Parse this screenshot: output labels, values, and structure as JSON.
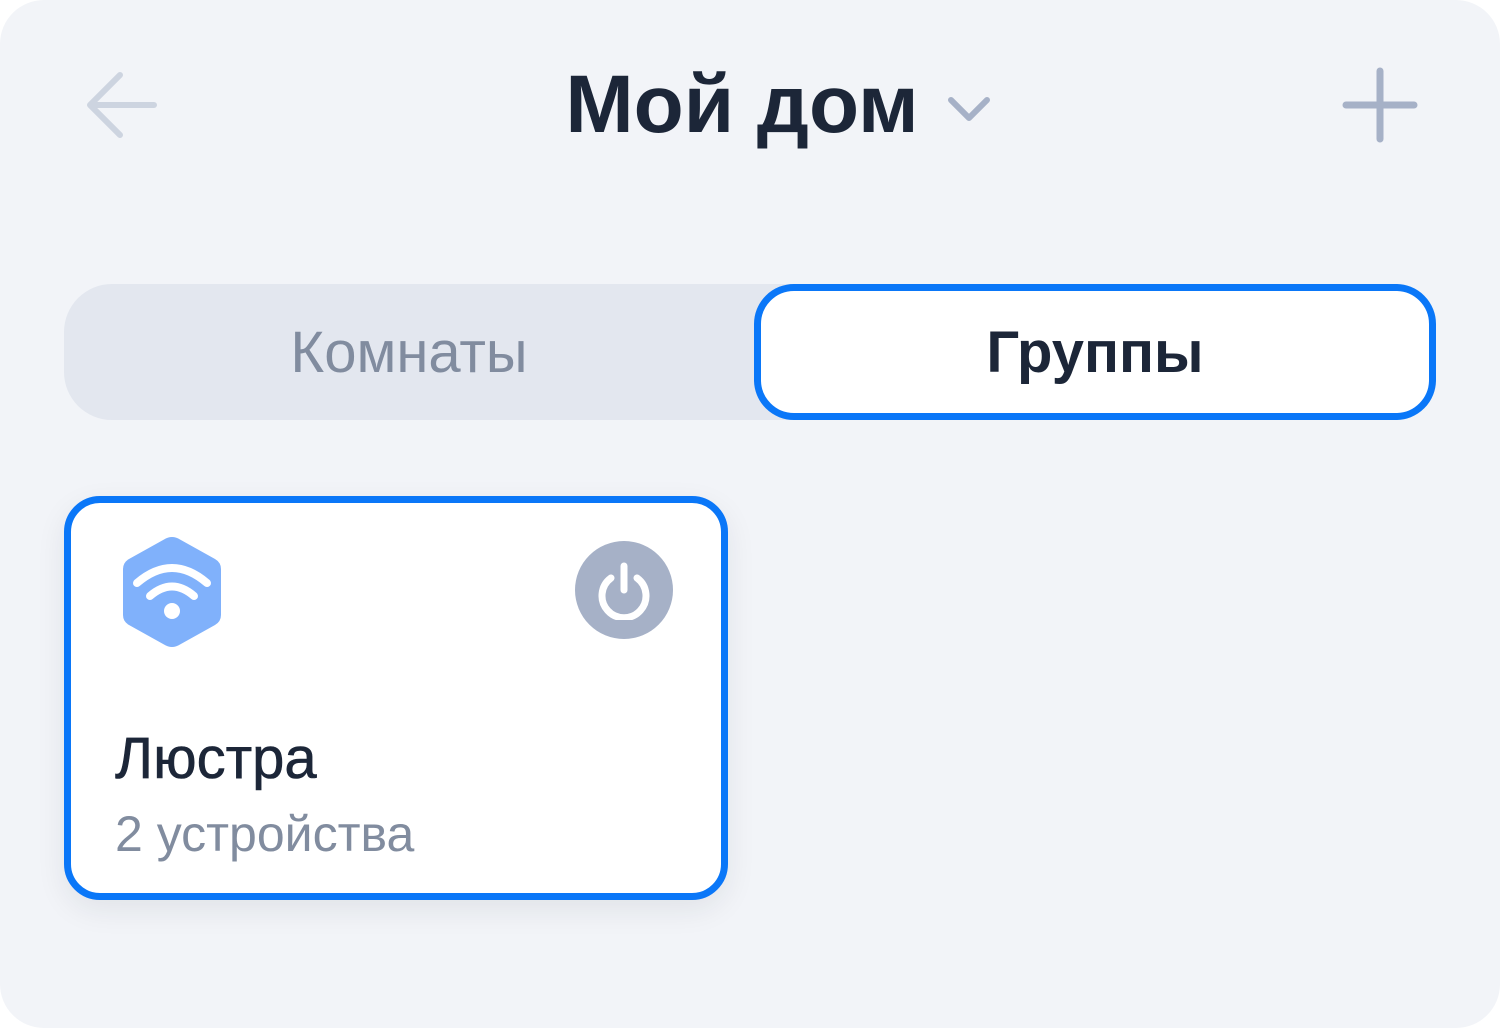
{
  "header": {
    "back_icon": "arrow-left-icon",
    "title": "Мой дом",
    "dropdown_icon": "chevron-down-icon",
    "add_icon": "plus-icon"
  },
  "tabs": [
    {
      "label": "Комнаты",
      "selected": false
    },
    {
      "label": "Группы",
      "selected": true
    }
  ],
  "groups": [
    {
      "name": "Люстра",
      "subtitle": "2 устройства",
      "icon": "wifi-hexagon-icon",
      "power_icon": "power-icon",
      "power_on": false
    }
  ],
  "colors": {
    "background": "#f2f4f8",
    "accent": "#0a77f8",
    "title_text": "#1c2638",
    "muted_text": "#818c9f",
    "icon_muted": "#a6b1c7",
    "group_icon_fill": "#80b1fb",
    "segment_bg": "#e3e7ef"
  }
}
